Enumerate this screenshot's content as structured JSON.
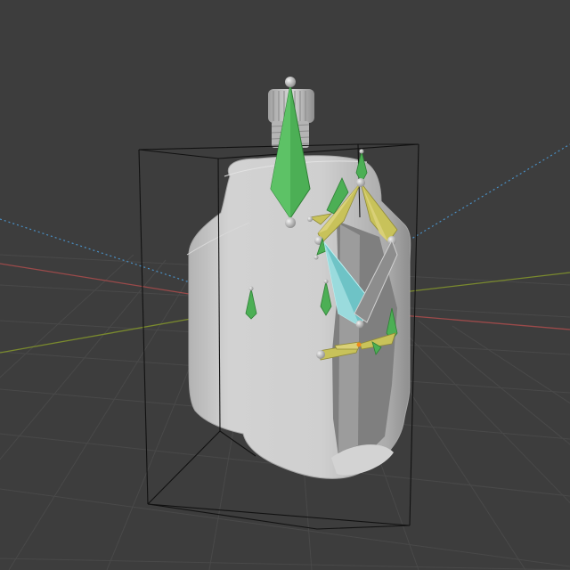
{
  "viewport": {
    "background_color": "#3d3d3d",
    "grid_color": "#484848",
    "x_axis_color": "#9b4a4a",
    "y_axis_color": "#7a8a2e",
    "light_guide_color": "#4a8fc4",
    "bounding_box_color": "#111111"
  },
  "object": {
    "type": "bottle-pouch-mesh",
    "body_color": "#c9c9c9",
    "shadow_color": "#8f8f8f",
    "cap_color": "#bdbdbd"
  },
  "armature": {
    "bone_primary_color": "#4caf55",
    "bone_secondary_color": "#c8c25a",
    "bone_selected_color": "#8ad6d8",
    "joint_color": "#d0d0d0",
    "active_joint_color": "#f08a1c"
  }
}
